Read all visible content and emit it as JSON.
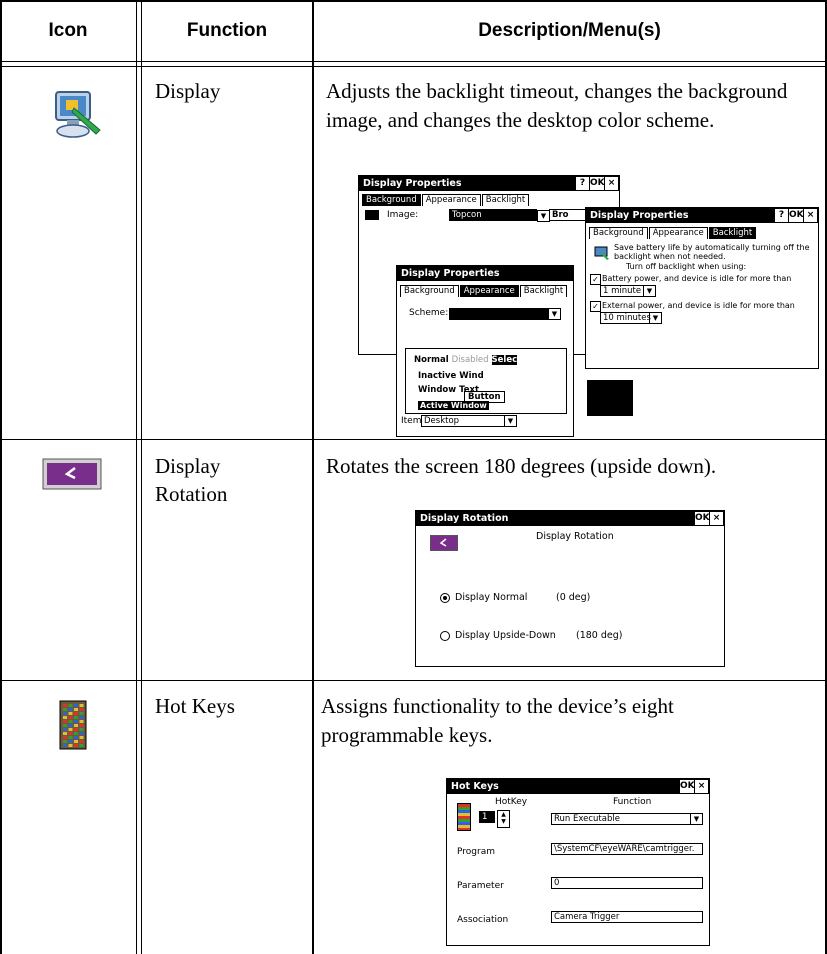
{
  "table": {
    "headers": {
      "icon": "Icon",
      "function": "Function",
      "description": "Description/Menu(s)"
    },
    "rows": [
      {
        "function": "Display",
        "description": "Adjusts the backlight timeout, changes the background image, and changes the desktop color scheme.",
        "screenshot": {
          "dlg1": {
            "title": "Display Properties",
            "help": "?",
            "ok": "OK",
            "close": "×",
            "tabs": [
              "Background",
              "Appearance",
              "Backlight"
            ],
            "image_label": "Image:",
            "image_value": "Topcon",
            "browse": "Bro"
          },
          "dlg2": {
            "title": "Display Properties",
            "tabs": [
              "Background",
              "Appearance",
              "Backlight"
            ],
            "scheme_label": "Scheme:",
            "preview_tabs": [
              "Normal",
              "Disabled",
              "Selec"
            ],
            "inactive": "Inactive Wind",
            "window_text": "Window Text",
            "button": "Button",
            "active": "Active Window",
            "item_label": "Item:",
            "item_value": "Desktop"
          },
          "dlg3": {
            "title": "Display Properties",
            "tabs": [
              "Background",
              "Appearance",
              "Backlight"
            ],
            "intro": "Save battery life by automatically turning off the backlight when not needed.",
            "turnoff": "Turn off backlight when using:",
            "battery": "Battery power, and device is idle for more than",
            "battery_value": "1 minute",
            "external": "External power, and device is idle for more than",
            "external_value": "10 minutes"
          }
        }
      },
      {
        "function": "Display Rotation",
        "description": "Rotates the screen 180 degrees (upside down).",
        "screenshot": {
          "title": "Display Rotation",
          "ok": "OK",
          "close": "×",
          "heading": "Display Rotation",
          "normal_label": "Display Normal",
          "normal_deg": "(0 deg)",
          "upside_label": "Display Upside-Down",
          "upside_deg": "(180 deg)"
        }
      },
      {
        "function": "Hot Keys",
        "description": " Assigns functionality to the device’s eight programmable keys.",
        "screenshot": {
          "title": "Hot Keys",
          "ok": "OK",
          "close": "×",
          "hotkey_label": "HotKey",
          "function_label": "Function",
          "hotkey_value": "1",
          "function_value": "Run Executable",
          "program_label": "Program",
          "program_value": "\\SystemCF\\eyeWARE\\camtrigger.",
          "parameter_label": "Parameter",
          "parameter_value": "0",
          "association_label": "Association",
          "association_value": "Camera Trigger"
        }
      }
    ]
  },
  "colors": {
    "rotation_icon_bg": "#7a2e8c",
    "display_icon_arm": "#2fa84f",
    "monitor_blue": "#4a88c8"
  },
  "icons": [
    "display-icon",
    "rotation-icon",
    "hotkeys-icon"
  ]
}
